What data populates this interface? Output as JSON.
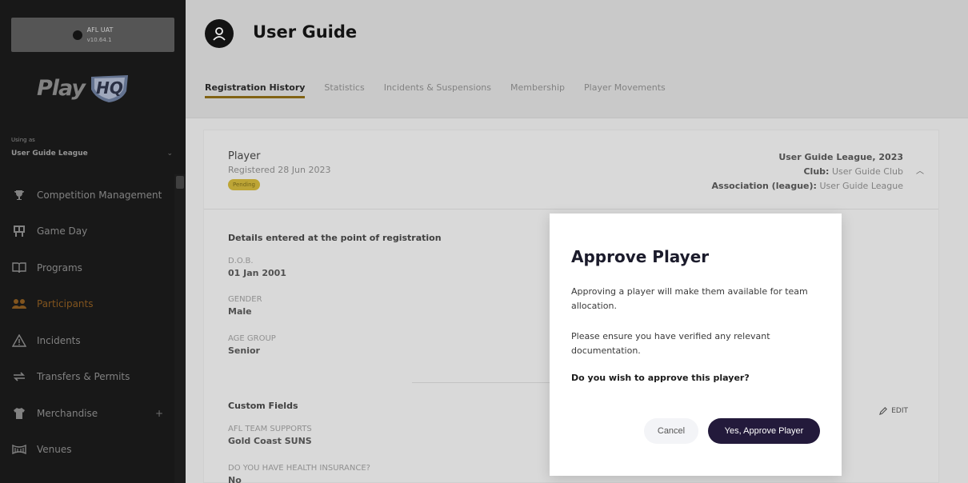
{
  "environment": {
    "name": "AFL UAT",
    "version": "v10.64.1"
  },
  "logo": {
    "play": "Play",
    "hq": "HQ"
  },
  "sidebar": {
    "using_as_label": "Using as",
    "league": "User Guide League",
    "items": [
      {
        "label": "Competition Management",
        "icon": "trophy-icon"
      },
      {
        "label": "Game Day",
        "icon": "scoreboard-icon"
      },
      {
        "label": "Programs",
        "icon": "book-icon"
      },
      {
        "label": "Participants",
        "icon": "people-icon",
        "active": true
      },
      {
        "label": "Incidents",
        "icon": "warning-icon"
      },
      {
        "label": "Transfers & Permits",
        "icon": "transfer-icon"
      },
      {
        "label": "Merchandise",
        "icon": "shirt-icon",
        "expand": "+"
      },
      {
        "label": "Venues",
        "icon": "venue-icon"
      }
    ]
  },
  "header": {
    "title": "User Guide",
    "tabs": [
      "Registration History",
      "Statistics",
      "Incidents & Suspensions",
      "Membership",
      "Player Movements"
    ]
  },
  "registration": {
    "title": "Player",
    "registered": "Registered 28 Jun 2023",
    "status": "Pending",
    "season": "User Guide League, 2023",
    "club_label": "Club:",
    "club_value": "User Guide Club",
    "association_label": "Association (league):",
    "association_value": "User Guide League",
    "details_heading": "Details entered at the point of registration",
    "fields": [
      {
        "label": "D.O.B.",
        "value": "01 Jan 2001"
      },
      {
        "label": "GENDER",
        "value": "Male"
      },
      {
        "label": "AGE GROUP",
        "value": "Senior"
      }
    ],
    "custom_heading": "Custom Fields",
    "edit_label": "EDIT",
    "custom_fields": [
      {
        "label": "AFL TEAM SUPPORTS",
        "value": "Gold Coast SUNS"
      },
      {
        "label": "DO YOU HAVE HEALTH INSURANCE?",
        "value": "No"
      }
    ]
  },
  "modal": {
    "title": "Approve Player",
    "paragraph1": "Approving a player will make them available for team allocation.",
    "paragraph2": "Please ensure you have verified any relevant documentation.",
    "question": "Do you wish to approve this player?",
    "cancel_label": "Cancel",
    "approve_label": "Yes, Approve Player"
  },
  "colors": {
    "sidebar_bg": "#1a1a1a",
    "accent": "#8a6a16",
    "approve_button": "#231a3b",
    "pending_badge": "#c9b03a"
  }
}
